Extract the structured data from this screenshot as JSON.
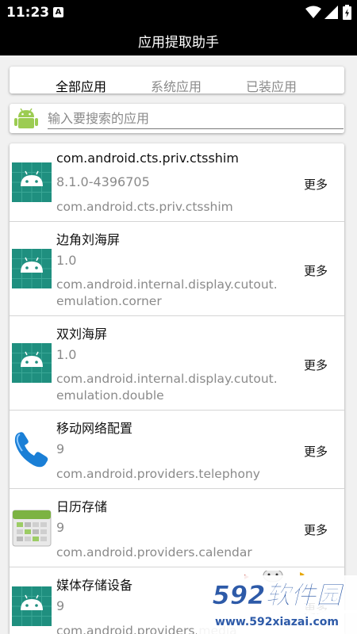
{
  "status_bar": {
    "time": "11:23",
    "notification": "A"
  },
  "app_bar": {
    "title": "应用提取助手"
  },
  "tabs": [
    {
      "label": "全部应用",
      "active": true
    },
    {
      "label": "系统应用",
      "active": false
    },
    {
      "label": "已装应用",
      "active": false
    }
  ],
  "search": {
    "placeholder": "输入要搜索的应用",
    "value": ""
  },
  "apps": [
    {
      "name": "com.android.cts.priv.ctsshim",
      "version": "8.1.0-4396705",
      "package": "com.android.cts.priv.ctsshim",
      "more": "更多",
      "icon": "android-icon"
    },
    {
      "name": "边角刘海屏",
      "version": "1.0",
      "package": "com.android.internal.display.cutout.\nemulation.corner",
      "more": "更多",
      "icon": "android-icon"
    },
    {
      "name": "双刘海屏",
      "version": "1.0",
      "package": "com.android.internal.display.cutout.\nemulation.double",
      "more": "更多",
      "icon": "android-icon"
    },
    {
      "name": "移动网络配置",
      "version": "9",
      "package": "com.android.providers.telephony",
      "more": "更多",
      "icon": "phone-icon"
    },
    {
      "name": "日历存储",
      "version": "9",
      "package": "com.android.providers.calendar",
      "more": "更多",
      "icon": "calendar-icon"
    },
    {
      "name": "媒体存储设备",
      "version": "9",
      "package": "com.android.providers.media",
      "more": "更多",
      "icon": "android-icon"
    }
  ],
  "watermark": {
    "brand": "592软件园",
    "url": "www.592xiazai.com"
  },
  "colors": {
    "bar": "#000000",
    "android_tile": "#1f8f7f",
    "android_head": "#9ccc52",
    "watermark_blue": "#2d5aa8"
  }
}
